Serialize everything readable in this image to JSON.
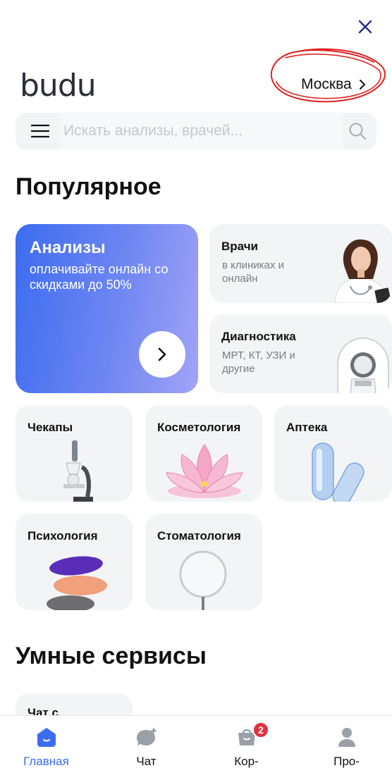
{
  "header": {
    "logo": "budu",
    "city": "Москва"
  },
  "search": {
    "placeholder": "Искать анализы, врачей..."
  },
  "sections": {
    "popular": "Популярное",
    "smart": "Умные сервисы"
  },
  "cards": {
    "analyses": {
      "title": "Анализы",
      "subtitle": "оплачивайте онлайн со скидками до 50%"
    },
    "doctors": {
      "title": "Врачи",
      "subtitle": "в клиниках и онлайн"
    },
    "diagnostics": {
      "title": "Диагностика",
      "subtitle": "МРТ, КТ, УЗИ и другие"
    },
    "checkups": {
      "title": "Чекапы"
    },
    "cosmetology": {
      "title": "Косметология"
    },
    "pharmacy": {
      "title": "Аптека"
    },
    "psychology": {
      "title": "Психология"
    },
    "dentistry": {
      "title": "Стоматология"
    },
    "chat": {
      "title": "Чат с"
    }
  },
  "nav": {
    "items": [
      {
        "label": "Главная",
        "icon": "home-icon",
        "active": true
      },
      {
        "label": "Чат",
        "icon": "chat-icon",
        "active": false
      },
      {
        "label": "Кор-",
        "icon": "cart-icon",
        "active": false,
        "badge": "2"
      },
      {
        "label": "Про-",
        "icon": "profile-icon",
        "active": false
      }
    ]
  },
  "colors": {
    "accent": "#3c6cf0",
    "badge": "#e03341",
    "card_bg": "#f3f4f6",
    "scribble": "#e02020"
  }
}
